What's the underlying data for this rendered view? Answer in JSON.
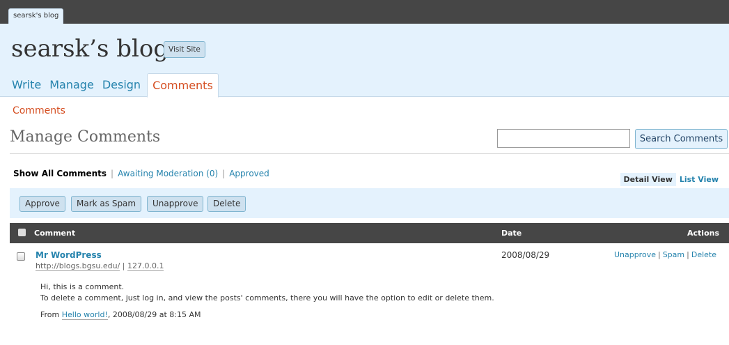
{
  "top": {
    "site_tab": "searsk's blog"
  },
  "header": {
    "blog_title": "searsk’s blog",
    "visit_site": "Visit Site",
    "nav": [
      "Write",
      "Manage",
      "Design",
      "Comments"
    ]
  },
  "subnav": "Comments",
  "page": {
    "title": "Manage Comments",
    "search_button": "Search Comments",
    "search_value": ""
  },
  "filters": {
    "all": "Show All Comments",
    "awaiting": "Awaiting Moderation (0)",
    "approved": "Approved",
    "view_detail": "Detail View",
    "view_list": "List View"
  },
  "actions": [
    "Approve",
    "Mark as Spam",
    "Unapprove",
    "Delete"
  ],
  "table": {
    "headers": {
      "comment": "Comment",
      "date": "Date",
      "actions": "Actions"
    },
    "row": {
      "author": "Mr WordPress",
      "url": "http://blogs.bgsu.edu/",
      "sep": "|",
      "ip": "127.0.0.1",
      "line1": "Hi, this is a comment.",
      "line2": "To delete a comment, just log in, and view the posts' comments, there you will have the option to edit or delete them.",
      "from_prefix": "From",
      "from_post": "Hello world!",
      "from_suffix": ", 2008/08/29 at 8:15 AM",
      "date": "2008/08/29",
      "act_unapprove": "Unapprove",
      "act_spam": "Spam",
      "act_delete": "Delete"
    }
  }
}
